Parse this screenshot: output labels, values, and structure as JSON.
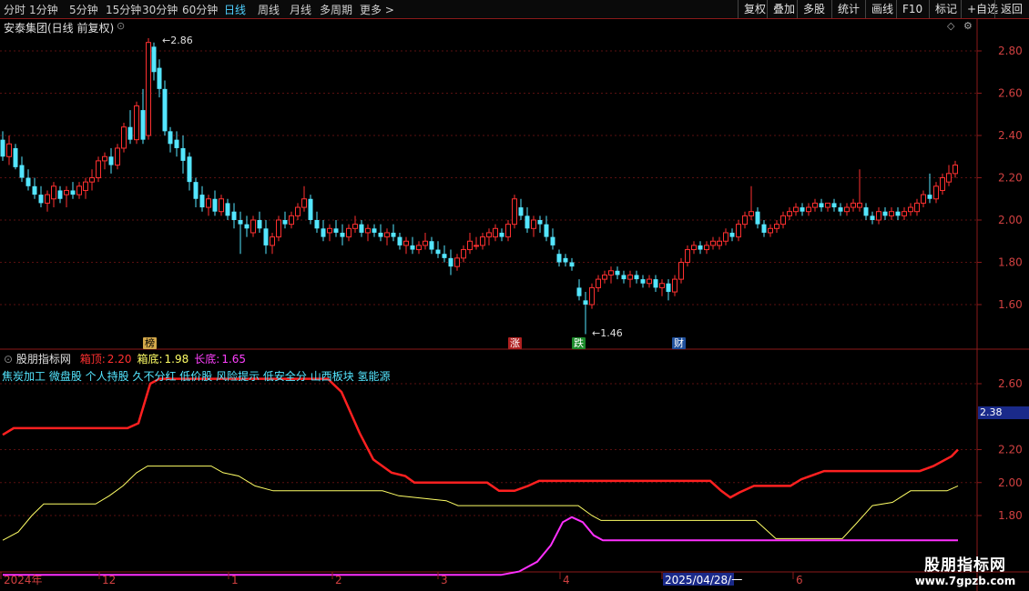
{
  "toolbar": {
    "periods": [
      "分时",
      "1分钟",
      "5分钟",
      "15分钟",
      "30分钟",
      "60分钟",
      "日线",
      "周线",
      "月线",
      "多周期",
      "更多 >"
    ],
    "active_period": "日线",
    "right_buttons": [
      "复权",
      "叠加",
      "多股",
      "统计",
      "画线",
      "F10",
      "标记",
      "+自选",
      "返回"
    ]
  },
  "main_chart": {
    "title": "安泰集团(日线 前复权)",
    "high_label": "2.86",
    "low_label": "1.46",
    "y_ticks": [
      "2.80",
      "2.60",
      "2.40",
      "2.20",
      "2.00",
      "1.80",
      "1.60"
    ],
    "markers": [
      {
        "label": "榜",
        "color": "#d4a84a",
        "text_color": "#000"
      },
      {
        "label": "涨",
        "color": "#b02020",
        "text_color": "#fff"
      },
      {
        "label": "跌",
        "color": "#1c8a2a",
        "text_color": "#fff"
      },
      {
        "label": "财",
        "color": "#1e4f9c",
        "text_color": "#fff"
      }
    ],
    "colors": {
      "up": "#ff3030",
      "down": "#54e6ff"
    }
  },
  "indicator": {
    "name": "股朋指标网",
    "fields": [
      {
        "label": "箱顶:",
        "value": "2.20",
        "color": "#ff3030"
      },
      {
        "label": "箱底:",
        "value": "1.98",
        "color": "#ffff66"
      },
      {
        "label": "长底:",
        "value": "1.65",
        "color": "#ff40ff"
      }
    ],
    "concepts": "焦炭加工 微盘股 个人持股 久不分红 低价股 风险提示 低安全分 山西板块 氢能源",
    "y_ticks": [
      "2.60",
      "2.20",
      "2.00",
      "1.80"
    ],
    "cursor_value": "2.38"
  },
  "x_axis": {
    "labels": [
      "2024年",
      "12",
      "1",
      "2",
      "3",
      "4",
      "2025/04/28/一",
      "6"
    ]
  },
  "watermark": {
    "title": "股朋指标网",
    "url": "www.7gpzb.com"
  }
}
